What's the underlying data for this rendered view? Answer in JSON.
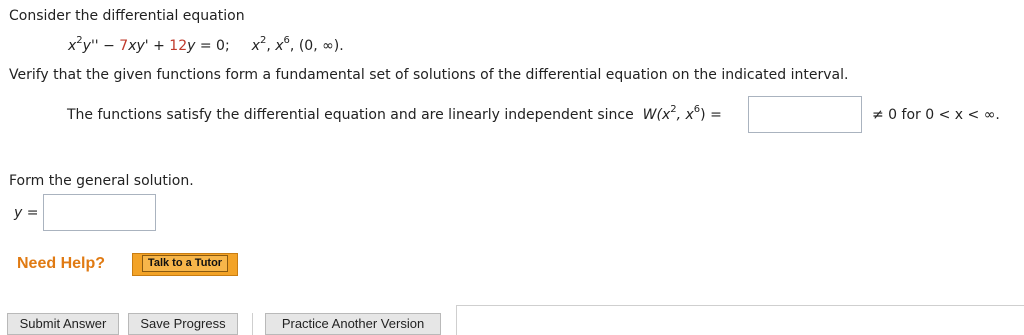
{
  "question": {
    "intro": "Consider the differential equation",
    "equation": {
      "p1": "x",
      "p1_sup": "2",
      "p2": "y''",
      "p3": " − ",
      "p4_coef": "7",
      "p5": "xy'",
      "p6": " + ",
      "p7_coef": "12",
      "p8": "y",
      "p9": " = 0;",
      "f1": "x",
      "f1_sup": "2",
      "sep1": ", ",
      "f2": "x",
      "f2_sup": "6",
      "interval": ", (0, ∞)."
    },
    "instruction": "Verify that the given functions form a fundamental set of solutions of the differential equation on the indicated interval.",
    "statement": {
      "text": "The functions satisfy the differential equation and are linearly independent since",
      "w1": "W(x",
      "w1_sup": "2",
      "w2": ", x",
      "w2_sup": "6",
      "w3": ") =",
      "after": "≠ 0  for  0 < x < ∞."
    },
    "general_prompt": "Form the general solution.",
    "y_label": "y =",
    "wronskian_value": "",
    "general_value": ""
  },
  "help": {
    "label": "Need Help?",
    "tutor_button": "Talk to a Tutor"
  },
  "actions": {
    "submit": "Submit Answer",
    "save": "Save Progress",
    "practice": "Practice Another Version"
  },
  "colors": {
    "accent_red": "#c0392b",
    "help_orange": "#e07a12",
    "tutor_button": "#f3a327"
  }
}
